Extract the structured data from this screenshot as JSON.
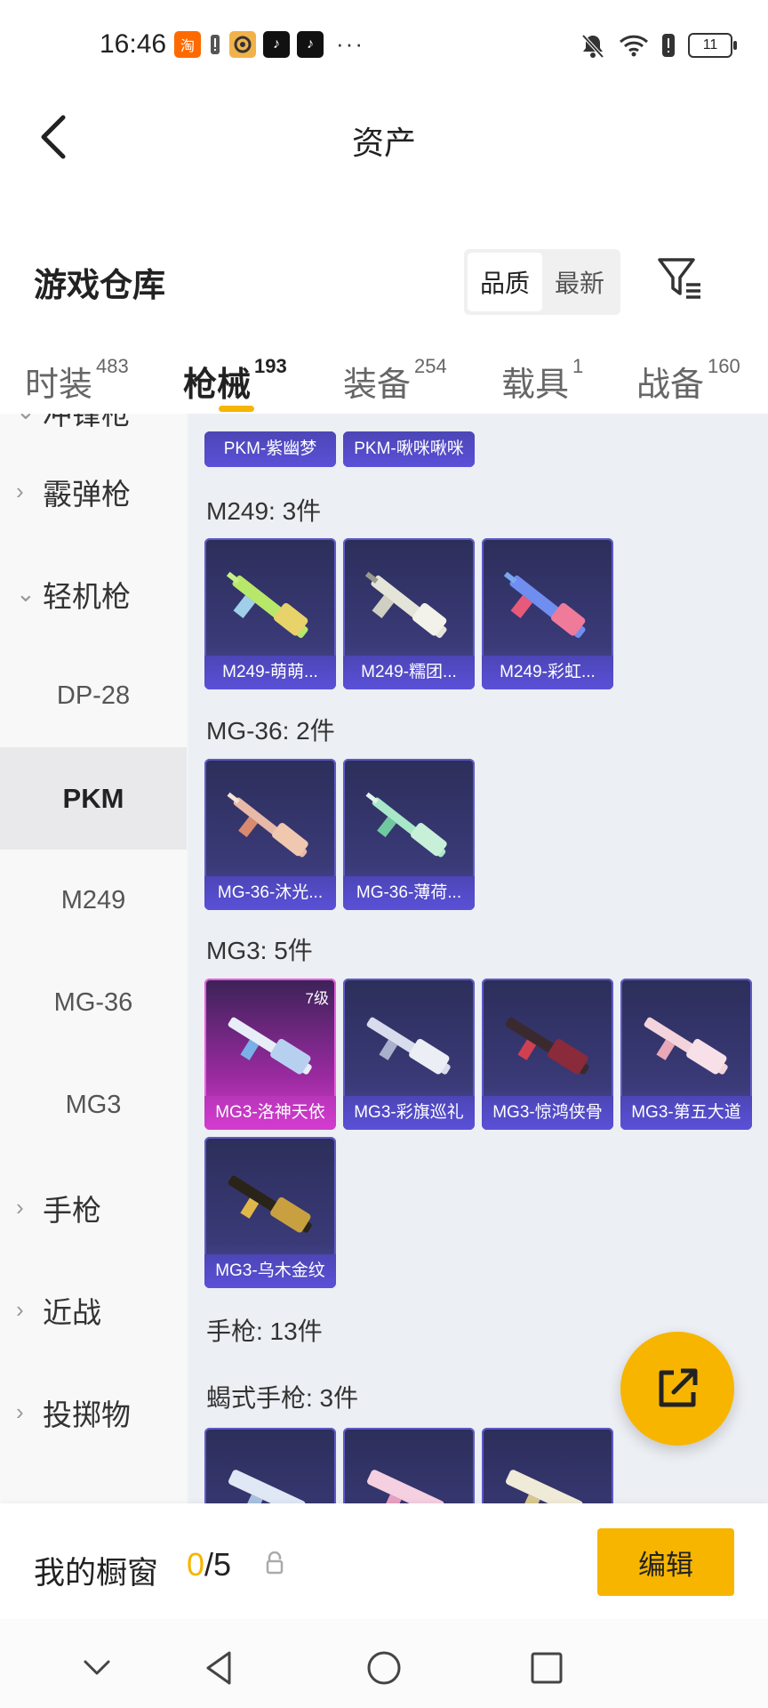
{
  "status_bar": {
    "time": "16:46",
    "battery": "11"
  },
  "nav": {
    "title": "资产"
  },
  "warehouse": {
    "title": "游戏仓库",
    "sort_options": [
      "品质",
      "最新"
    ],
    "active_sort": 0
  },
  "tabs": [
    {
      "label": "时装",
      "count": "483"
    },
    {
      "label": "枪械",
      "count": "193"
    },
    {
      "label": "装备",
      "count": "254"
    },
    {
      "label": "载具",
      "count": "1"
    },
    {
      "label": "战备",
      "count": "160"
    }
  ],
  "active_tab": 1,
  "sidebar": {
    "items": [
      {
        "label": "冲锋枪",
        "type": "group",
        "expanded": true
      },
      {
        "label": "霰弹枪",
        "type": "group",
        "expanded": false
      },
      {
        "label": "轻机枪",
        "type": "group",
        "expanded": true
      },
      {
        "label": "DP-28",
        "type": "sub"
      },
      {
        "label": "PKM",
        "type": "sub",
        "active": true
      },
      {
        "label": "M249",
        "type": "sub"
      },
      {
        "label": "MG-36",
        "type": "sub"
      },
      {
        "label": "MG3",
        "type": "sub"
      },
      {
        "label": "手枪",
        "type": "group",
        "expanded": false
      },
      {
        "label": "近战",
        "type": "group",
        "expanded": false
      },
      {
        "label": "投掷物",
        "type": "group",
        "expanded": false
      }
    ]
  },
  "content": {
    "top_cards": [
      "PKM-紫幽梦",
      "PKM-啾咪啾咪"
    ],
    "sections": [
      {
        "title": "M249: 3件",
        "cards": [
          "M249-萌萌...",
          "M249-糯团...",
          "M249-彩虹..."
        ]
      },
      {
        "title": "MG-36: 2件",
        "cards": [
          "MG-36-沐光...",
          "MG-36-薄荷..."
        ]
      },
      {
        "title": "MG3: 5件",
        "cards": [
          "MG3-洛神天依",
          "MG3-彩旗巡礼",
          "MG3-惊鸿侠骨",
          "MG3-第五大道",
          "MG3-乌木金纹"
        ],
        "first_level": "7级"
      },
      {
        "title": "手枪: 13件"
      },
      {
        "title": "蝎式手枪: 3件"
      }
    ]
  },
  "showcase": {
    "title": "我的橱窗",
    "current": "0",
    "total": "/5",
    "edit_label": "编辑"
  },
  "colors": {
    "accent": "#f7b500",
    "card_purple": "#3a3a78",
    "card_pink": "#d23ec8"
  }
}
